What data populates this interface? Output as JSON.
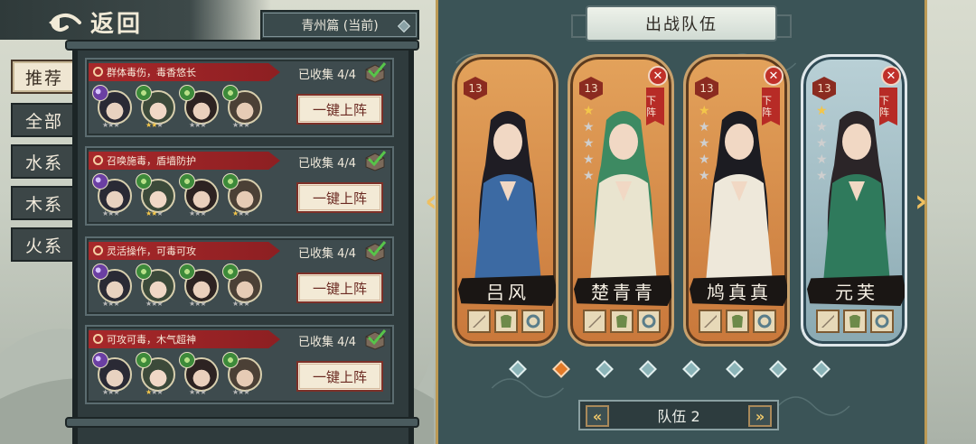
{
  "header": {
    "back_label": "返回",
    "chapter_label": "青州篇 (当前)"
  },
  "tabs": [
    {
      "label": "推荐",
      "active": true
    },
    {
      "label": "全部",
      "active": false
    },
    {
      "label": "水系",
      "active": false
    },
    {
      "label": "木系",
      "active": false
    },
    {
      "label": "火系",
      "active": false
    }
  ],
  "recommend": [
    {
      "desc": "群体毒伤，毒香悠长",
      "collected": "已收集 4/4",
      "button": "一键上阵",
      "heroes": [
        {
          "element": "yin-yang",
          "stars": 0
        },
        {
          "element": "wood",
          "stars": 2
        },
        {
          "element": "wood",
          "stars": 0
        },
        {
          "element": "wood",
          "stars": 0
        }
      ]
    },
    {
      "desc": "召唤施毒，盾墙防护",
      "collected": "已收集 4/4",
      "button": "一键上阵",
      "heroes": [
        {
          "element": "yin-yang",
          "stars": 0
        },
        {
          "element": "wood",
          "stars": 2
        },
        {
          "element": "wood",
          "stars": 0
        },
        {
          "element": "wood",
          "stars": 1
        }
      ]
    },
    {
      "desc": "灵活操作，可毒可攻",
      "collected": "已收集 4/4",
      "button": "一键上阵",
      "heroes": [
        {
          "element": "yin-yang",
          "stars": 0
        },
        {
          "element": "wood",
          "stars": 0
        },
        {
          "element": "wood",
          "stars": 0
        },
        {
          "element": "wood",
          "stars": 0
        }
      ]
    },
    {
      "desc": "可攻可毒，木气超神",
      "collected": "已收集 4/4",
      "button": "一键上阵",
      "heroes": [
        {
          "element": "yin-yang",
          "stars": 0
        },
        {
          "element": "wood",
          "stars": 1
        },
        {
          "element": "wood",
          "stars": 0
        },
        {
          "element": "wood",
          "stars": 0
        }
      ]
    }
  ],
  "team": {
    "title": "出战队伍",
    "remove_label": "下阵",
    "members": [
      {
        "name": "吕风",
        "level": "13",
        "stars": 0,
        "removable": false,
        "frame": "orange"
      },
      {
        "name": "楚青青",
        "level": "13",
        "stars": 1,
        "removable": true,
        "frame": "orange"
      },
      {
        "name": "鸠真真",
        "level": "13",
        "stars": 1,
        "removable": true,
        "frame": "orange"
      },
      {
        "name": "元芙",
        "level": "13",
        "stars": 1,
        "removable": true,
        "frame": "blue"
      }
    ],
    "page_count": 8,
    "active_page": 2,
    "selector_label": "队伍 2"
  },
  "colors": {
    "accent_red": "#a7282a",
    "frame_gold": "#c9a16c",
    "panel_teal": "#3b5457",
    "active_dot": "#e37a28"
  }
}
